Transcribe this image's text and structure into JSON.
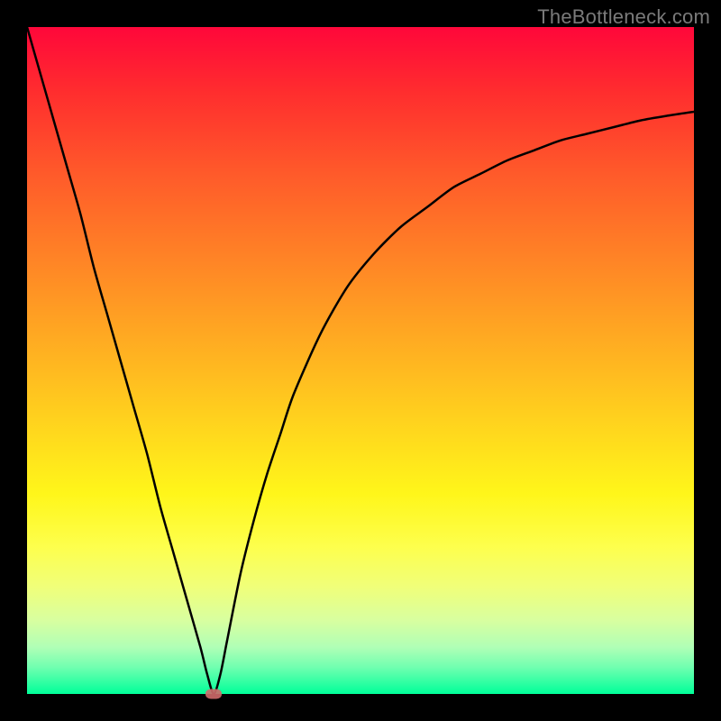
{
  "watermark": "TheBottleneck.com",
  "colors": {
    "frame": "#000000",
    "curve": "#000000",
    "marker": "#cf6a6a"
  },
  "chart_data": {
    "type": "line",
    "title": "",
    "xlabel": "",
    "ylabel": "",
    "xlim": [
      0,
      100
    ],
    "ylim": [
      0,
      100
    ],
    "grid": false,
    "legend": false,
    "annotations": [],
    "x": [
      0,
      2,
      4,
      6,
      8,
      10,
      12,
      14,
      16,
      18,
      20,
      22,
      24,
      26,
      27,
      28,
      29,
      30,
      32,
      34,
      36,
      38,
      40,
      44,
      48,
      52,
      56,
      60,
      64,
      68,
      72,
      76,
      80,
      84,
      88,
      92,
      96,
      100
    ],
    "values": [
      100,
      93,
      86,
      79,
      72,
      64,
      57,
      50,
      43,
      36,
      28,
      21,
      14,
      7,
      3,
      0,
      3,
      8,
      18,
      26,
      33,
      39,
      45,
      54,
      61,
      66,
      70,
      73,
      76,
      78,
      80,
      81.5,
      83,
      84,
      85,
      86,
      86.7,
      87.3
    ],
    "marker": {
      "x": 28,
      "y": 0
    }
  }
}
